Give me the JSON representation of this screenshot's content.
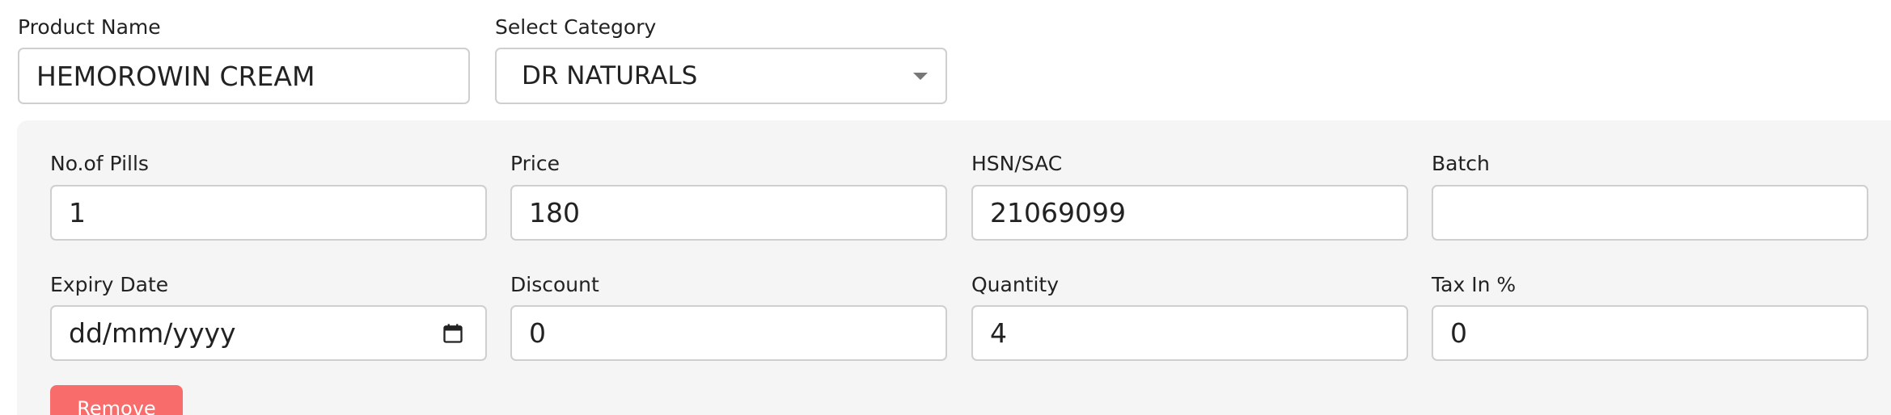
{
  "product": {
    "name_label": "Product Name",
    "name_value": "HEMOROWIN CREAM"
  },
  "category": {
    "label": "Select Category",
    "selected": "DR NATURALS"
  },
  "details": {
    "pills_label": "No.of Pills",
    "pills_value": "1",
    "price_label": "Price",
    "price_value": "180",
    "hsn_label": "HSN/SAC",
    "hsn_value": "21069099",
    "batch_label": "Batch",
    "batch_value": "",
    "expiry_label": "Expiry Date",
    "expiry_placeholder": "dd/mm/yyyy",
    "discount_label": "Discount",
    "discount_value": "0",
    "quantity_label": "Quantity",
    "quantity_value": "4",
    "tax_label": "Tax In %",
    "tax_value": "0"
  },
  "actions": {
    "remove_label": "Remove"
  },
  "colors": {
    "panel_background": "#f5f5f5",
    "input_border": "#cfcfcf",
    "remove_button": "#f86c6b"
  }
}
